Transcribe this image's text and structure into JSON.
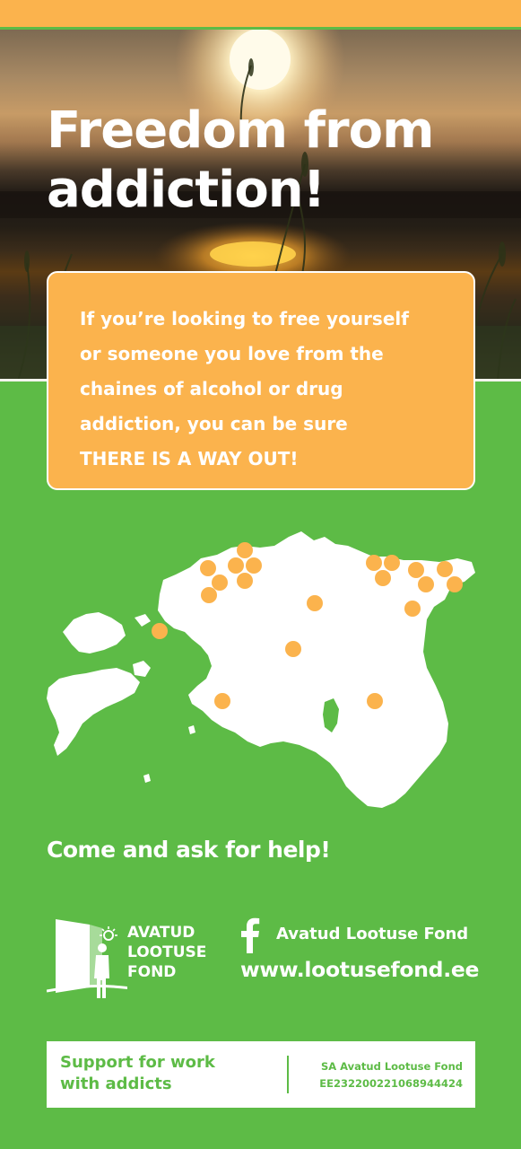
{
  "hero": {
    "title_line1": "Freedom from",
    "title_line2": "addiction!"
  },
  "intro": {
    "lines": [
      "If you’re looking to free yourself",
      "or someone you love from the",
      "chaines of alcohol or drug",
      "addiction, you can be sure",
      "THERE IS A WAY OUT!"
    ]
  },
  "map": {
    "region": "Estonia",
    "marker_color": "#fbb34d",
    "land_color": "#ffffff"
  },
  "cta": "Come and ask for help!",
  "logo": {
    "lines": [
      "AVATUD",
      "LOOTUSE",
      "FOND"
    ],
    "icon": "open-door-person-icon"
  },
  "contact": {
    "facebook_icon": "facebook-icon",
    "facebook_name": "Avatud Lootuse Fond",
    "website": "www.lootusefond.ee"
  },
  "support": {
    "lines": [
      "Support for work",
      "with addicts"
    ],
    "org_name": "SA Avatud Lootuse Fond",
    "account": "EE232200221068944424"
  },
  "colors": {
    "green": "#5dbb46",
    "orange": "#fbb34d",
    "white": "#ffffff"
  }
}
